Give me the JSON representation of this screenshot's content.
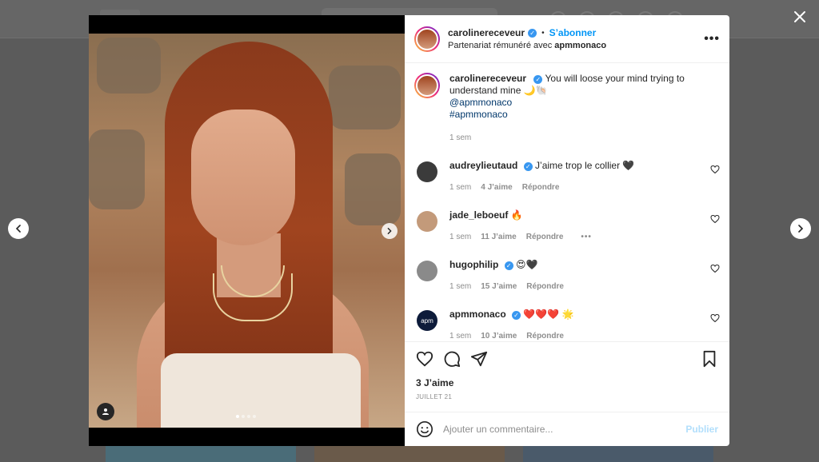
{
  "post": {
    "author": "carolinereceveur",
    "follow_label": "S’abonner",
    "separator": "•",
    "partnership_prefix": "Partenariat rémunéré avec",
    "partner": "apmmonaco",
    "more_label": "•••",
    "media": {
      "slide_count": 4,
      "active_slide": 1
    }
  },
  "caption": {
    "author": "carolinereceveur",
    "text": "You will loose your mind trying to understand mine 🌙🐚",
    "mention": "@apmmonaco",
    "hashtag": "#apmmonaco",
    "time": "1 sem"
  },
  "comments": [
    {
      "user": "audreylieutaud",
      "text": "J’aime trop le collier 🖤",
      "time": "1 sem",
      "likes": "4 J’aime",
      "reply": "Répondre",
      "avatar_color": "#3b3b3b"
    },
    {
      "user": "jade_leboeuf",
      "text": "🔥",
      "time": "1 sem",
      "likes": "11 J’aime",
      "reply": "Répondre",
      "more": "•••",
      "avatar_color": "#c39a7a"
    },
    {
      "user": "hugophilip",
      "text": "😍🖤",
      "time": "1 sem",
      "likes": "15 J’aime",
      "reply": "Répondre",
      "avatar_color": "#8a8a8a"
    },
    {
      "user": "apmmonaco",
      "text": "❤️❤️❤️ 🌟",
      "time": "1 sem",
      "likes": "10 J’aime",
      "reply": "Répondre",
      "avatar_color": "#0d1b3a",
      "avatar_text": "apm"
    }
  ],
  "actions": {
    "likes": "3 J’aime",
    "date": "JUILLET 21"
  },
  "add_comment": {
    "placeholder": "Ajouter un commentaire...",
    "publish_label": "Publier"
  },
  "icons": {
    "close": "close-icon",
    "prev": "chevron-left-icon",
    "next": "chevron-right-icon",
    "like": "heart-icon",
    "comment": "comment-icon",
    "share": "send-icon",
    "save": "bookmark-icon",
    "emoji": "smiley-icon",
    "tag": "user-tag-icon"
  },
  "colors": {
    "accent": "#0095f6",
    "verified": "#3897f0",
    "publish_disabled": "#b2dffc"
  }
}
